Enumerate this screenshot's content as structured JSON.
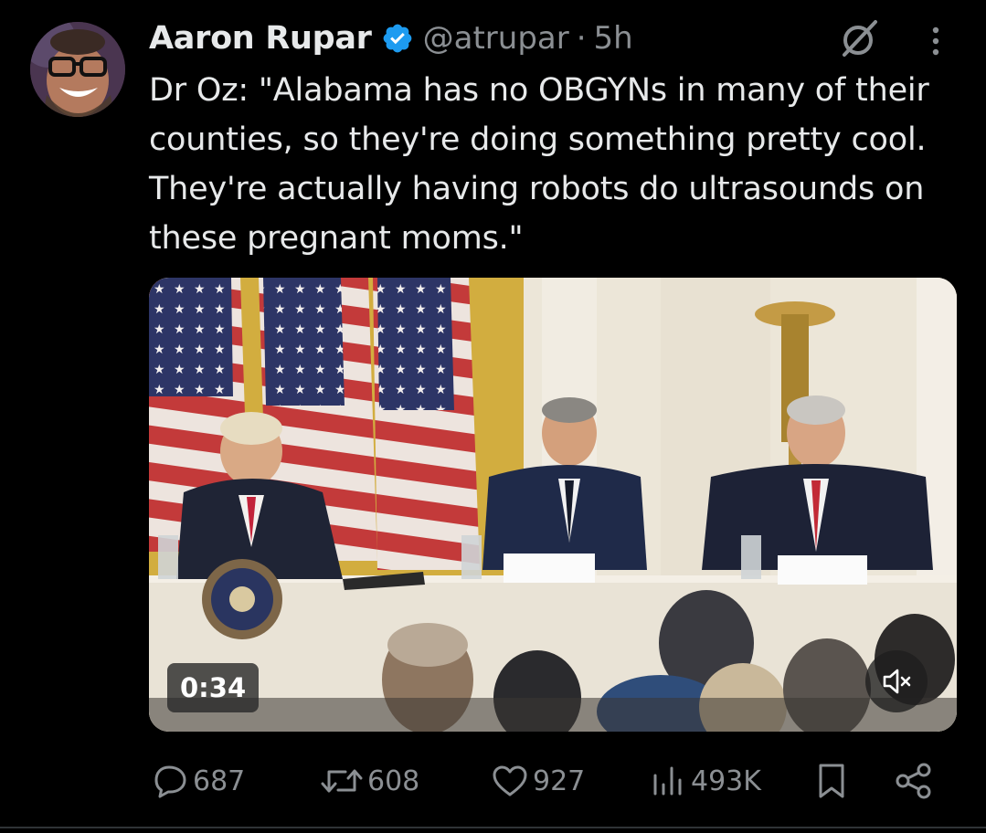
{
  "author": {
    "display_name": "Aaron Rupar",
    "handle": "@atrupar",
    "separator": "·",
    "time": "5h",
    "verified": true,
    "avatar_icon": "profile-photo"
  },
  "tweet": {
    "text": "Dr Oz: \"Alabama has no OBGYNs in many of their counties, so they're doing something pretty cool. They're actually having robots do ultrasounds on these pregnant moms.\""
  },
  "video": {
    "duration": "0:34",
    "muted": true,
    "mute_icon": "speaker-muted-icon"
  },
  "actions": {
    "replies": "687",
    "reposts": "608",
    "likes": "927",
    "views": "493K",
    "bookmark_icon": "bookmark-icon",
    "share_icon": "share-icon"
  },
  "colors": {
    "background": "#000000",
    "primary_text": "#e7e9ea",
    "secondary_text": "#8b8f93",
    "verified_blue": "#1d9bf0"
  }
}
